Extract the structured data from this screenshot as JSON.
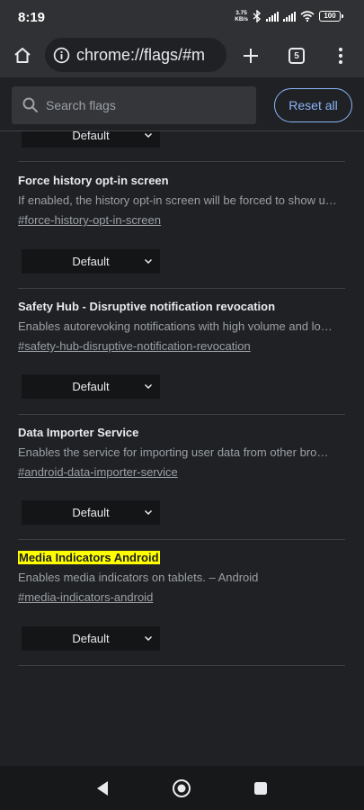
{
  "status_bar": {
    "time": "8:19",
    "net_speed_value": "3.75",
    "net_speed_unit": "KB/s",
    "battery": "100",
    "icons": [
      "bluetooth-icon",
      "signal-icon",
      "signal-icon",
      "wifi-icon",
      "battery-icon"
    ]
  },
  "toolbar": {
    "url": "chrome://flags/#m",
    "tab_count": "5",
    "icons": [
      "home-icon",
      "info-icon",
      "plus-icon",
      "tab-switcher-icon",
      "more-vert-icon"
    ]
  },
  "header": {
    "search_placeholder": "Search flags",
    "reset_label": "Reset all"
  },
  "partial_flag": {
    "dropdown_value": "Default"
  },
  "flags": [
    {
      "title": "Force history opt-in screen",
      "description": "If enabled, the history opt-in screen will be forced to show u…",
      "link": "#force-history-opt-in-screen",
      "dropdown_value": "Default"
    },
    {
      "title": "Safety Hub - Disruptive notification revocation",
      "description": "Enables autorevoking notifications with high volume and lo…",
      "link": "#safety-hub-disruptive-notification-revocation",
      "dropdown_value": "Default"
    },
    {
      "title": "Data Importer Service",
      "description": "Enables the service for importing user data from other bro…",
      "link": "#android-data-importer-service",
      "dropdown_value": "Default"
    },
    {
      "title": "Media Indicators Android",
      "description": "Enables media indicators on tablets. – Android",
      "link": "#media-indicators-android",
      "dropdown_value": "Default",
      "highlighted": true
    }
  ],
  "colors": {
    "background": "#202124",
    "accent": "#8ab4f8",
    "highlight": "#ffff00"
  },
  "nav_bar": {
    "icons": [
      "back-icon",
      "home-circle-icon",
      "recents-icon"
    ]
  }
}
